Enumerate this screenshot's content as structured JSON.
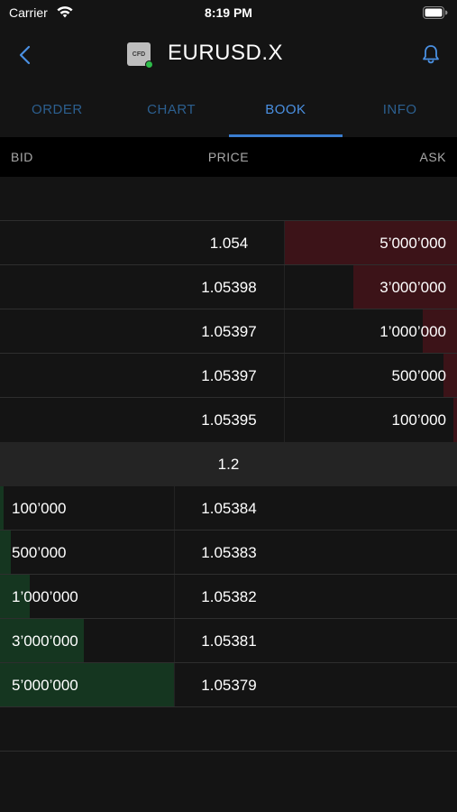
{
  "status": {
    "carrier": "Carrier",
    "time": "8:19 PM"
  },
  "nav": {
    "badge": "CFD",
    "title": "EURUSD.X"
  },
  "tabs": [
    {
      "label": "ORDER",
      "active": false
    },
    {
      "label": "CHART",
      "active": false
    },
    {
      "label": "BOOK",
      "active": true
    },
    {
      "label": "INFO",
      "active": false
    }
  ],
  "columns": {
    "bid": "BID",
    "price": "PRICE",
    "ask": "ASK"
  },
  "asks": [
    {
      "price": "1.054",
      "size": "5’000’000",
      "depth": 1.0
    },
    {
      "price": "1.05398",
      "size": "3’000’000",
      "depth": 0.6
    },
    {
      "price": "1.05397",
      "size": "1’000’000",
      "depth": 0.2
    },
    {
      "price": "1.05397",
      "size": "500’000",
      "depth": 0.08
    },
    {
      "price": "1.05395",
      "size": "100’000",
      "depth": 0.02
    }
  ],
  "spread": "1.2",
  "bids": [
    {
      "price": "1.05384",
      "size": "100’000",
      "depth": 0.02
    },
    {
      "price": "1.05383",
      "size": "500’000",
      "depth": 0.06
    },
    {
      "price": "1.05382",
      "size": "1’000’000",
      "depth": 0.17
    },
    {
      "price": "1.05381",
      "size": "3’000’000",
      "depth": 0.48
    },
    {
      "price": "1.05379",
      "size": "5’000’000",
      "depth": 1.0
    }
  ],
  "colors": {
    "accent": "#4a90e2",
    "ask_depth": "#3c1318",
    "bid_depth": "#153620"
  }
}
